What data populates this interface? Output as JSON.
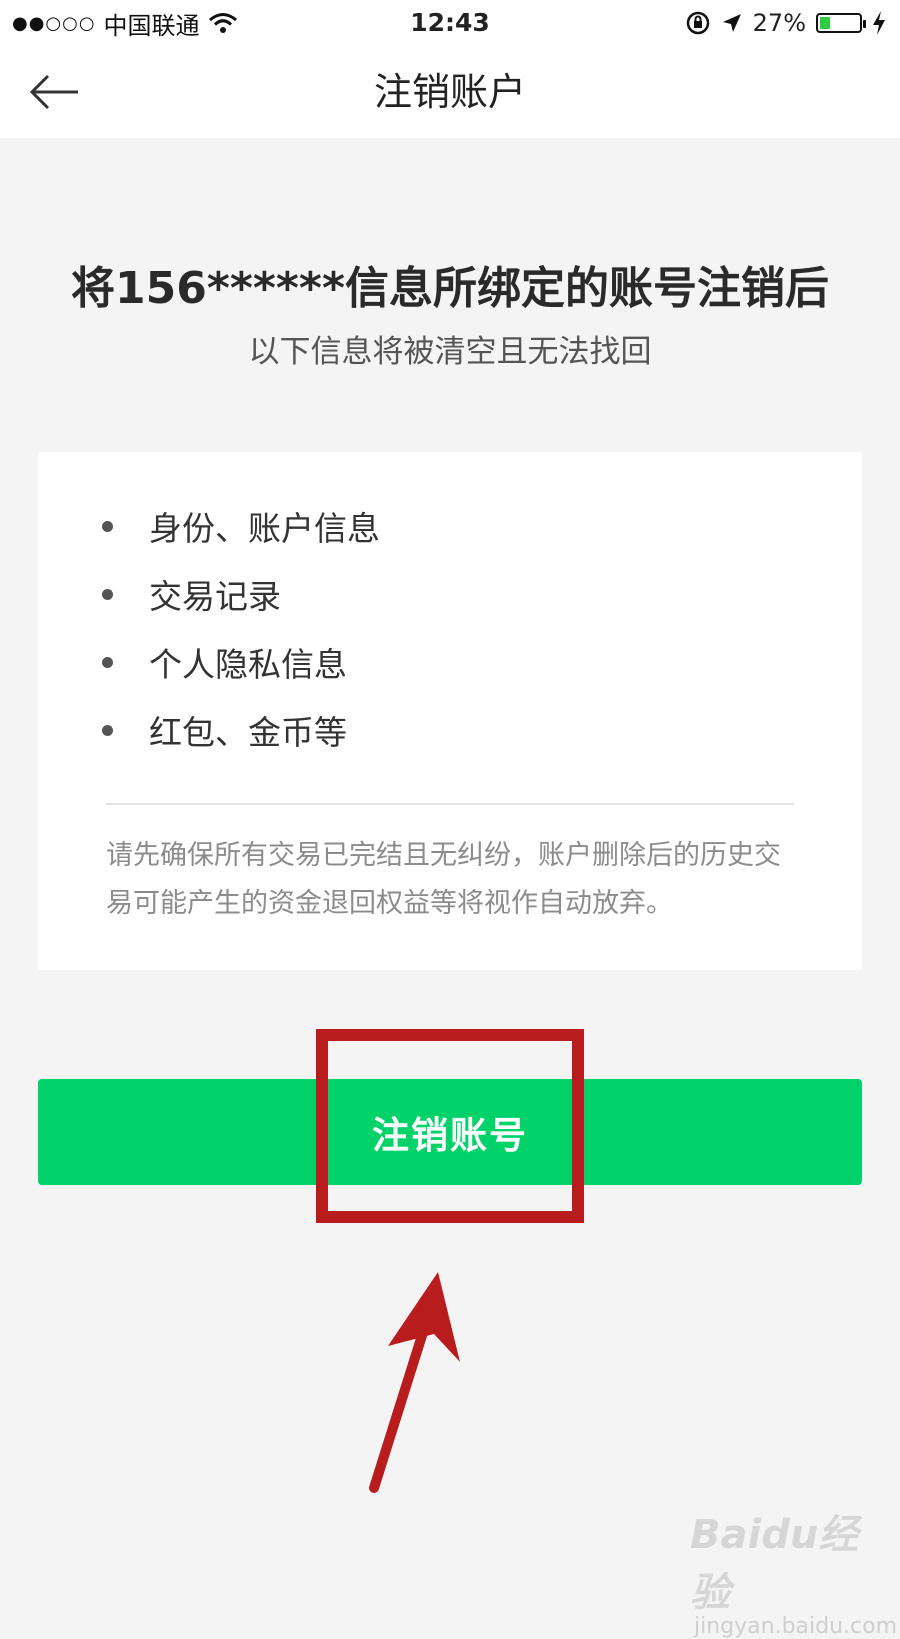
{
  "status_bar": {
    "signal": "●●○○○",
    "carrier": "中国联通",
    "time": "12:43",
    "battery_percent": "27%",
    "battery_level": 0.27
  },
  "nav": {
    "title": "注销账户"
  },
  "headline": "将156******信息所绑定的账号注销后",
  "subheadline": "以下信息将被清空且无法找回",
  "info_items": [
    {
      "label": "身份、账户信息"
    },
    {
      "label": "交易记录"
    },
    {
      "label": "个人隐私信息"
    },
    {
      "label": "红包、金币等"
    }
  ],
  "notice": "请先确保所有交易已完结且无纠纷，账户删除后的历史交易可能产生的资金退回权益等将视作自动放弃。",
  "primary_button": {
    "label": "注销账号"
  },
  "watermark": {
    "logo": "Baidu经验",
    "url": "jingyan.baidu.com"
  },
  "colors": {
    "accent_green": "#00d26a",
    "highlight_red": "#b81c1c",
    "background": "#f4f4f4"
  },
  "icons": {
    "back": "back-arrow-icon",
    "wifi": "wifi-icon",
    "rotation_lock": "rotation-lock-icon",
    "location": "location-arrow-icon",
    "charging": "charging-bolt-icon"
  }
}
